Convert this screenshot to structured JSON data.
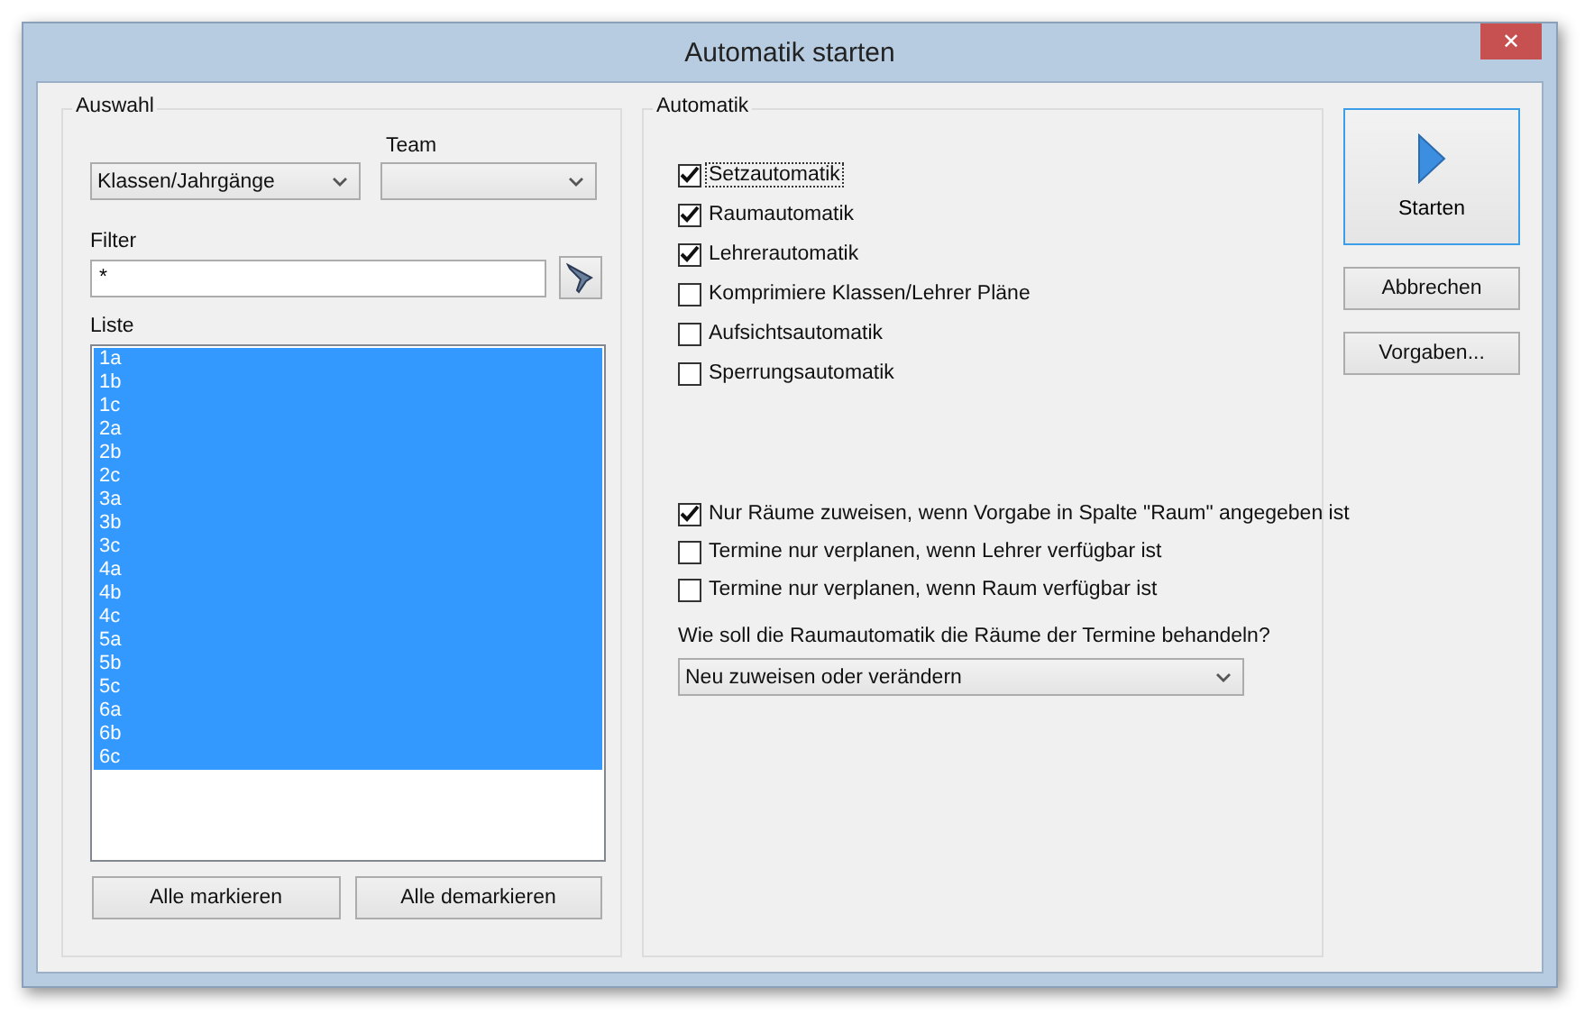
{
  "window": {
    "title": "Automatik starten",
    "close": "✕"
  },
  "auswahl": {
    "title": "Auswahl",
    "type_select": {
      "value": "Klassen/Jahrgänge"
    },
    "team": {
      "label": "Team"
    },
    "filter": {
      "label": "Filter",
      "value": "*"
    },
    "list_label": "Liste",
    "items": [
      {
        "label": "1a",
        "selected": true
      },
      {
        "label": "1b",
        "selected": true
      },
      {
        "label": "1c",
        "selected": true
      },
      {
        "label": "2a",
        "selected": true
      },
      {
        "label": "2b",
        "selected": true
      },
      {
        "label": "2c",
        "selected": true
      },
      {
        "label": "3a",
        "selected": true
      },
      {
        "label": "3b",
        "selected": true
      },
      {
        "label": "3c",
        "selected": true
      },
      {
        "label": "4a",
        "selected": true
      },
      {
        "label": "4b",
        "selected": true
      },
      {
        "label": "4c",
        "selected": true
      },
      {
        "label": "5a",
        "selected": true
      },
      {
        "label": "5b",
        "selected": true
      },
      {
        "label": "5c",
        "selected": true
      },
      {
        "label": "6a",
        "selected": true
      },
      {
        "label": "6b",
        "selected": true
      },
      {
        "label": "6c",
        "selected": true
      }
    ],
    "buttons": [
      "Alle markieren",
      "Alle demarkieren"
    ]
  },
  "automatik": {
    "title": "Automatik",
    "options": [
      {
        "label": "Setzautomatik",
        "checked": true,
        "focused": true
      },
      {
        "label": "Raumautomatik",
        "checked": true,
        "focused": false
      },
      {
        "label": "Lehrerautomatik",
        "checked": true,
        "focused": false
      },
      {
        "label": "Komprimiere Klassen/Lehrer Pläne",
        "checked": false,
        "focused": false
      },
      {
        "label": "Aufsichtsautomatik",
        "checked": false,
        "focused": false
      },
      {
        "label": "Sperrungsautomatik",
        "checked": false,
        "focused": false
      }
    ],
    "conditions": [
      {
        "label": "Nur Räume zuweisen, wenn Vorgabe in Spalte \"Raum\" angegeben ist",
        "checked": true
      },
      {
        "label": "Termine nur verplanen, wenn Lehrer verfügbar ist",
        "checked": false
      },
      {
        "label": "Termine nur verplanen, wenn Raum verfügbar ist",
        "checked": false
      }
    ],
    "question": "Wie soll die Raumautomatik die Räume der Termine behandeln?",
    "room_mode": {
      "value": "Neu zuweisen oder verändern"
    }
  },
  "actions": {
    "start": "Starten",
    "cancel": "Abbrechen",
    "defaults": "Vorgaben..."
  }
}
